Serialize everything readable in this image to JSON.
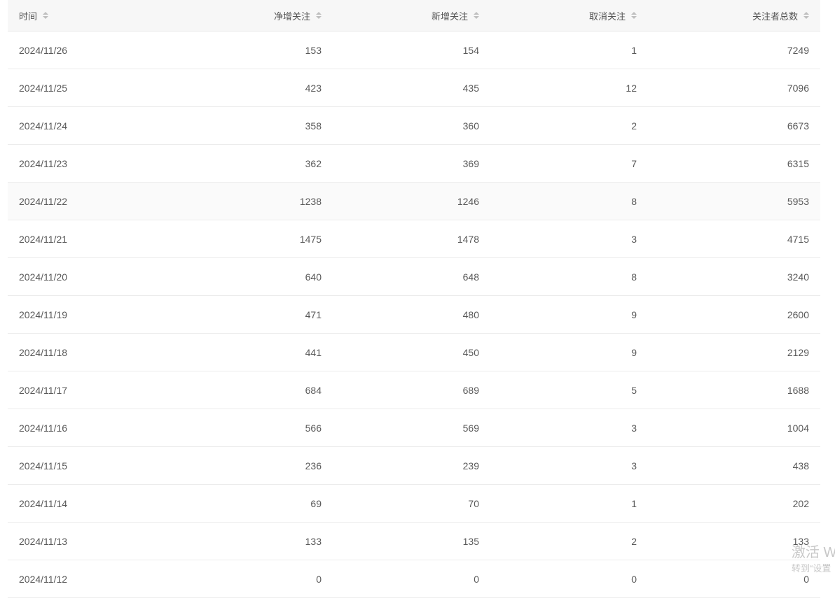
{
  "table": {
    "columns": [
      {
        "label": "时间"
      },
      {
        "label": "净增关注"
      },
      {
        "label": "新增关注"
      },
      {
        "label": "取消关注"
      },
      {
        "label": "关注者总数"
      }
    ],
    "rows": [
      [
        "2024/11/26",
        "153",
        "154",
        "1",
        "7249"
      ],
      [
        "2024/11/25",
        "423",
        "435",
        "12",
        "7096"
      ],
      [
        "2024/11/24",
        "358",
        "360",
        "2",
        "6673"
      ],
      [
        "2024/11/23",
        "362",
        "369",
        "7",
        "6315"
      ],
      [
        "2024/11/22",
        "1238",
        "1246",
        "8",
        "5953"
      ],
      [
        "2024/11/21",
        "1475",
        "1478",
        "3",
        "4715"
      ],
      [
        "2024/11/20",
        "640",
        "648",
        "8",
        "3240"
      ],
      [
        "2024/11/19",
        "471",
        "480",
        "9",
        "2600"
      ],
      [
        "2024/11/18",
        "441",
        "450",
        "9",
        "2129"
      ],
      [
        "2024/11/17",
        "684",
        "689",
        "5",
        "1688"
      ],
      [
        "2024/11/16",
        "566",
        "569",
        "3",
        "1004"
      ],
      [
        "2024/11/15",
        "236",
        "239",
        "3",
        "438"
      ],
      [
        "2024/11/14",
        "69",
        "70",
        "1",
        "202"
      ],
      [
        "2024/11/13",
        "133",
        "135",
        "2",
        "133"
      ],
      [
        "2024/11/12",
        "0",
        "0",
        "0",
        "0"
      ]
    ],
    "hovered_row": 4
  },
  "watermark": {
    "line1": "激活 W",
    "line2": "转到“设置"
  }
}
